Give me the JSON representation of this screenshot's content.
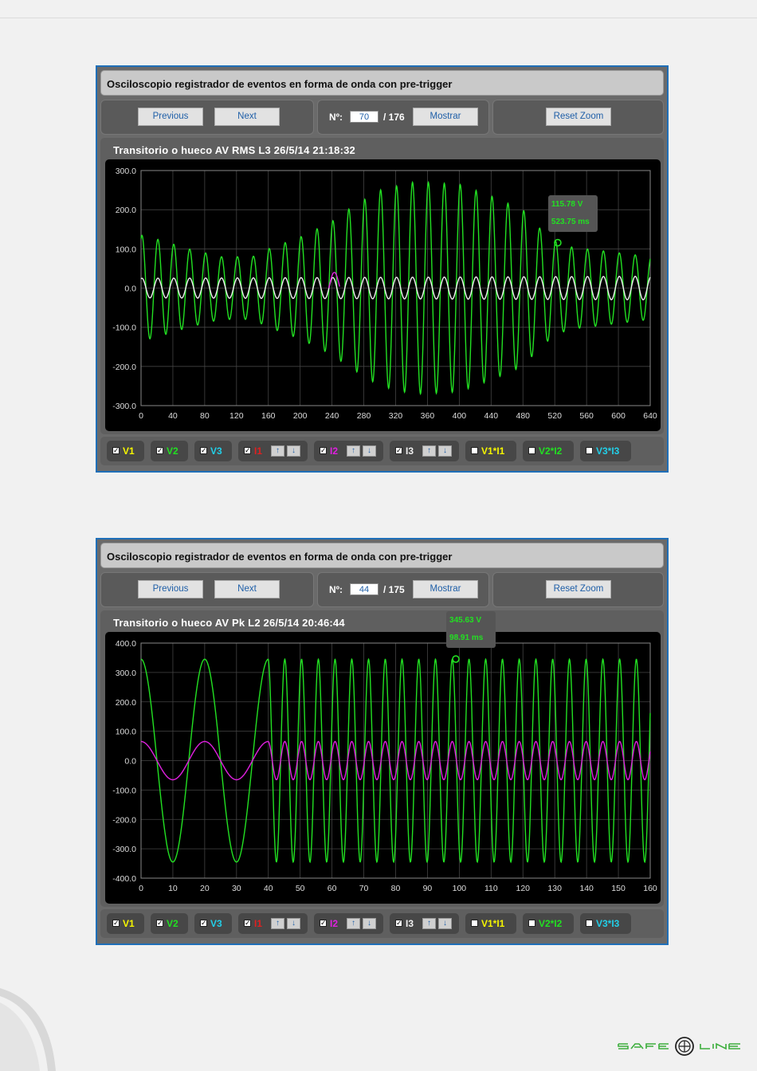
{
  "panels": [
    {
      "title": "Osciloscopio registrador de eventos en forma de onda con pre-trigger",
      "prev_label": "Previous",
      "next_label": "Next",
      "n_label": "Nº:",
      "n_value": "70",
      "n_total": "/ 176",
      "show_label": "Mostrar",
      "reset_label": "Reset Zoom",
      "chart_title": "Transitorio o hueco AV RMS L3 26/5/14 21:18:32",
      "tooltip": {
        "line1": "115.78 V",
        "line2": "523.75 ms"
      },
      "legend": [
        {
          "label": "V1",
          "color": "#f6f600",
          "checked": true,
          "arrows": false
        },
        {
          "label": "V2",
          "color": "#22e022",
          "checked": true,
          "arrows": false
        },
        {
          "label": "V3",
          "color": "#22cfe8",
          "checked": true,
          "arrows": false
        },
        {
          "label": "I1",
          "color": "#e02020",
          "checked": true,
          "arrows": true
        },
        {
          "label": "I2",
          "color": "#e020e0",
          "checked": true,
          "arrows": true
        },
        {
          "label": "I3",
          "color": "#f0f0f0",
          "checked": true,
          "arrows": true
        },
        {
          "label": "V1*I1",
          "color": "#f6f600",
          "checked": false,
          "arrows": false
        },
        {
          "label": "V2*I2",
          "color": "#22e022",
          "checked": false,
          "arrows": false
        },
        {
          "label": "V3*I3",
          "color": "#22cfe8",
          "checked": false,
          "arrows": false
        }
      ],
      "arrow_up": "↑",
      "arrow_down": "↓"
    },
    {
      "title": "Osciloscopio registrador de eventos en forma de onda con pre-trigger",
      "prev_label": "Previous",
      "next_label": "Next",
      "n_label": "Nº:",
      "n_value": "44",
      "n_total": "/ 175",
      "show_label": "Mostrar",
      "reset_label": "Reset Zoom",
      "chart_title": "Transitorio o hueco AV Pk L2 26/5/14 20:46:44",
      "tooltip": {
        "line1": "345.63 V",
        "line2": "98.91 ms"
      },
      "legend": [
        {
          "label": "V1",
          "color": "#f6f600",
          "checked": true,
          "arrows": false
        },
        {
          "label": "V2",
          "color": "#22e022",
          "checked": true,
          "arrows": false
        },
        {
          "label": "V3",
          "color": "#22cfe8",
          "checked": true,
          "arrows": false
        },
        {
          "label": "I1",
          "color": "#e02020",
          "checked": true,
          "arrows": true
        },
        {
          "label": "I2",
          "color": "#e020e0",
          "checked": true,
          "arrows": true
        },
        {
          "label": "I3",
          "color": "#f0f0f0",
          "checked": true,
          "arrows": true
        },
        {
          "label": "V1*I1",
          "color": "#f6f600",
          "checked": false,
          "arrows": false
        },
        {
          "label": "V2*I2",
          "color": "#22e022",
          "checked": false,
          "arrows": false
        },
        {
          "label": "V3*I3",
          "color": "#22cfe8",
          "checked": false,
          "arrows": false
        }
      ],
      "arrow_up": "↑",
      "arrow_down": "↓"
    }
  ],
  "chart_data": [
    {
      "type": "line",
      "title": "Transitorio o hueco AV RMS L3 26/5/14 21:18:32",
      "xlim": [
        0,
        640
      ],
      "ylim": [
        -300,
        300
      ],
      "xticks": [
        "0",
        "40",
        "80",
        "120",
        "160",
        "200",
        "240",
        "280",
        "320",
        "360",
        "400",
        "440",
        "480",
        "520",
        "560",
        "600",
        "640"
      ],
      "yticks": [
        "300.0",
        "200.0",
        "100.0",
        "0.0",
        "-100.0",
        "-200.0",
        "-300.0"
      ],
      "grid": true,
      "series": [
        {
          "color": "#22e022",
          "period_ms": 20,
          "amplitude_envelope": {
            "x": [
              0,
              20,
              60,
              100,
              140,
              160,
              200,
              220,
              240,
              260,
              300,
              340,
              360,
              400,
              440,
              480,
              500,
              520,
              540,
              580,
              620,
              640
            ],
            "y": [
              135,
              125,
              100,
              80,
              80,
              100,
              130,
              150,
              170,
              200,
              250,
              270,
              270,
              265,
              235,
              200,
              155,
              120,
              105,
              95,
              85,
              80
            ]
          }
        },
        {
          "color": "#f0f0f0",
          "period_ms": 20,
          "amplitude_envelope": {
            "x": [
              0,
              640
            ],
            "y": [
              25,
              30
            ]
          }
        },
        {
          "color": "#e020e0",
          "period_ms": 20,
          "amplitude_envelope": {
            "x": [
              236,
              250
            ],
            "y": [
              40,
              40
            ]
          }
        }
      ],
      "marker": {
        "x": 523.75,
        "y": 115.78
      }
    },
    {
      "type": "line",
      "title": "Transitorio o hueco AV Pk L2 26/5/14 20:46:44",
      "xlim": [
        0,
        160
      ],
      "ylim": [
        -400,
        400
      ],
      "xticks": [
        "0",
        "10",
        "20",
        "30",
        "40",
        "50",
        "60",
        "70",
        "80",
        "90",
        "100",
        "110",
        "120",
        "130",
        "140",
        "150",
        "160"
      ],
      "yticks": [
        "400.0",
        "300.0",
        "200.0",
        "100.0",
        "0.0",
        "-100.0",
        "-200.0",
        "-300.0",
        "-400.0"
      ],
      "grid": true,
      "series": [
        {
          "color": "#22e022",
          "amplitude": 345,
          "period_segments": [
            {
              "x": [
                0,
                40
              ],
              "period_ms": 20
            },
            {
              "x": [
                40,
                160
              ],
              "period_ms": 5.26
            }
          ]
        },
        {
          "color": "#e020e0",
          "amplitude": 65,
          "period_segments": [
            {
              "x": [
                0,
                40
              ],
              "period_ms": 20
            },
            {
              "x": [
                40,
                160
              ],
              "period_ms": 5.26
            }
          ]
        }
      ],
      "marker": {
        "x": 98.91,
        "y": 345.63
      }
    }
  ],
  "logo_text": "SAFE LINE"
}
